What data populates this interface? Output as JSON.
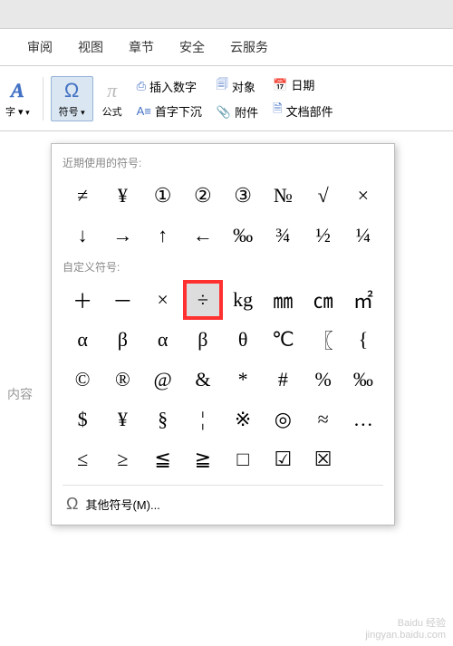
{
  "tabs": [
    "审阅",
    "视图",
    "章节",
    "安全",
    "云服务"
  ],
  "ribbon": {
    "wordart": "字 ▾",
    "symbol_label": "符号",
    "formula_label": "公式",
    "insert_number": "插入数字",
    "dropcap": "首字下沉",
    "object": "对象",
    "attachment": "附件",
    "date": "日期",
    "docparts": "文档部件"
  },
  "dropdown": {
    "recent_label": "近期使用的符号:",
    "recent": [
      "≠",
      "¥",
      "①",
      "②",
      "③",
      "№",
      "√",
      "×",
      "↓",
      "→",
      "↑",
      "←",
      "‰",
      "¾",
      "½",
      "¼"
    ],
    "custom_label": "自定义符号:",
    "custom": [
      "＋",
      "－",
      "×",
      "÷",
      "kg",
      "㎜",
      "㎝",
      "㎡",
      "α",
      "β",
      "α",
      "β",
      "θ",
      "℃",
      "〖",
      "{",
      "©",
      "®",
      "@",
      "&",
      "*",
      "#",
      "%",
      "‰",
      "$",
      "¥",
      "§",
      "¦",
      "※",
      "◎",
      "≈",
      "…",
      "≤",
      "≥",
      "≦",
      "≧",
      "□",
      "☑",
      "☒"
    ],
    "highlight_index": 3,
    "more": "其他符号(M)..."
  },
  "doc_placeholder": "内容",
  "watermark": {
    "brand": "Baidu 经验",
    "url": "jingyan.baidu.com"
  }
}
